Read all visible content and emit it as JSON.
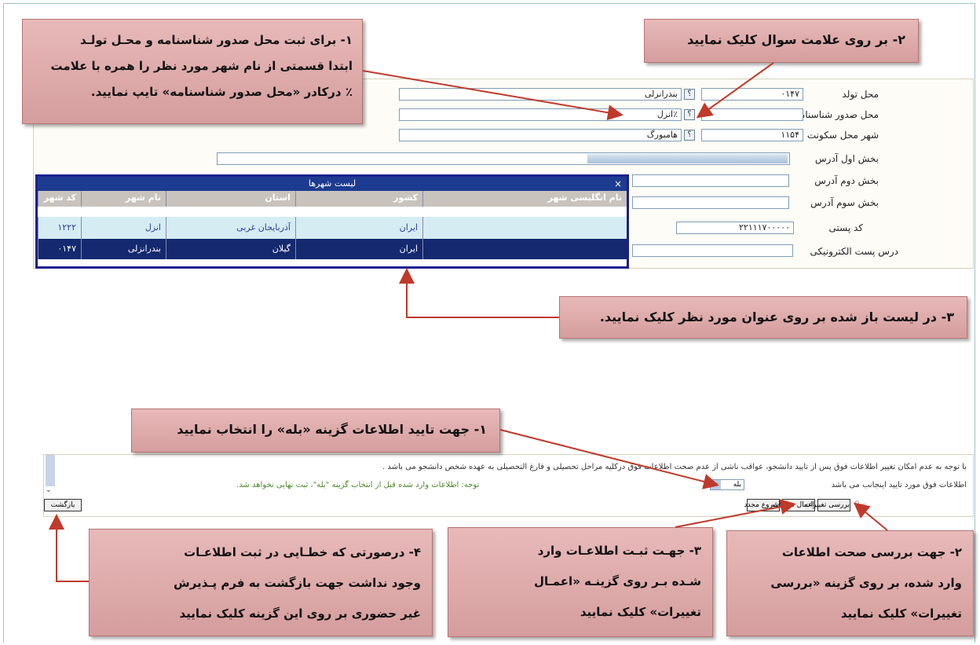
{
  "form": {
    "rows": [
      {
        "label": "محل تولد",
        "code": "۰۱۴۷",
        "value": "بندرانزلی"
      },
      {
        "label": "محل صدور شناسنامه",
        "code": "",
        "value": "٪انزل"
      },
      {
        "label": "شهر محل سکونت",
        "code": "۱۱۵۴",
        "value": "هامبورگ"
      }
    ],
    "address_rows": [
      {
        "label": "بخش اول آدرس"
      },
      {
        "label": "بخش دوم آدرس"
      },
      {
        "label": "بخش سوم آدرس"
      }
    ],
    "postal_label": "کد پستی",
    "postal_value": "۲۲۱۱۱۷۰۰۰۰۰",
    "email_label": "درس پست الکترونیکی",
    "question_button": "؟"
  },
  "city_list": {
    "title": "لیست شهرها",
    "close": "×",
    "headers": [
      "کد شهر",
      "نام شهر",
      "استان",
      "کشور",
      "نام انگلیسی شهر"
    ],
    "rows": [
      [
        "۱۲۲۲",
        "انزل",
        "آذربایجان غربی",
        "ایران",
        ""
      ],
      [
        "۰۱۴۷",
        "بندرانزلی",
        "گیلان",
        "ایران",
        ""
      ]
    ]
  },
  "callouts": {
    "top1": [
      "۱- برای ثبت محل صدور شناسنامه و محـل تولـد",
      "ابتدا قسمتی از نام شهر مورد نظر را همره با علامت",
      "٪ درکادر «محل صدور شناسنامه» تایپ نمایید."
    ],
    "top2": "۲- بر روی علامت سوال کلیک نمایید",
    "top3": "۳- در لیست باز شده بر روی عنوان مورد نظر کلیک نمایید.",
    "bot1": "۱- جهت تایید اطلاعات گزینه «بله» را انتخاب نمایید",
    "bot2": [
      "۲- جهت بررسی صحت اطلاعات",
      "وارد شده، بر روی گزینه «بررسی",
      "تغییرات» کلیک نمایید"
    ],
    "bot3": [
      "۳- جهـت ثبـت اطلاعـات وارد",
      "شـده بـر روی گزینـه «اعمـال",
      "تغییرات» کلیک نمایید"
    ],
    "bot4": [
      "۴- درصورتی که خطـایی در ثبت اطلاعـات",
      "وجود نداشت جهت بازگشت به فرم پـذیرش",
      "غیر حضوری بر روی این گزینه کلیک نمایید"
    ]
  },
  "confirm": {
    "line1": "با توجه به عدم امکان تغییر اطلاعات فوق پس از تایید دانشجو، عواقب ناشی از عدم صحت اطلاعات فوق درکلیه مراحل تحصیلی و فارغ التحصیلی به عهده شخص دانشجو می باشد .",
    "question": "اطلاعات فوق مورد تایید اینجانب می باشد",
    "select_value": "بله",
    "note": "توجه: اطلاعات وارد شده قبل از انتخاب گزینه \"بله\"، ثبت نهایی نخواهد شد."
  },
  "buttons": {
    "review": "بررسی تغییرات",
    "apply": "اعمال تغییرات",
    "restart": "شروع مجدد",
    "back": "بازگشت"
  },
  "colors": {
    "callout": "#d9a3a3",
    "arrow": "#c0392b",
    "list_title": "#1d3b90",
    "selected_row": "#14296f"
  }
}
